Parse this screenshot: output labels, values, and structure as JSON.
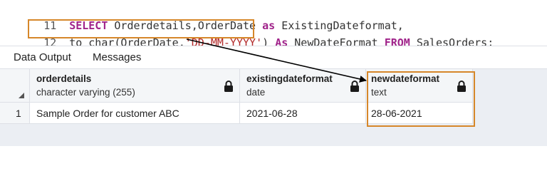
{
  "editor": {
    "lines": [
      {
        "number": "11",
        "tokens": [
          {
            "text": "SELECT",
            "kind": "keyword"
          },
          {
            "text": " Orderdetails,OrderDate ",
            "kind": "plain"
          },
          {
            "text": "as",
            "kind": "keyword"
          },
          {
            "text": " ExistingDateformat,",
            "kind": "plain"
          }
        ]
      },
      {
        "number": "12",
        "tokens": [
          {
            "text": "to_char(OrderDate,",
            "kind": "plain"
          },
          {
            "text": "'DD-MM-YYYY'",
            "kind": "string"
          },
          {
            "text": ") ",
            "kind": "plain"
          },
          {
            "text": "As",
            "kind": "keyword"
          },
          {
            "text": " NewDateFormat ",
            "kind": "plain"
          },
          {
            "text": "FROM",
            "kind": "keyword"
          },
          {
            "text": " SalesOrders;",
            "kind": "plain"
          }
        ]
      }
    ]
  },
  "tabs": [
    {
      "label": "Data Output",
      "active": true
    },
    {
      "label": "Messages",
      "active": false
    }
  ],
  "grid": {
    "columns": [
      {
        "name": "orderdetails",
        "type": "character varying (255)",
        "icon": "lock-icon"
      },
      {
        "name": "existingdateformat",
        "type": "date",
        "icon": "lock-icon"
      },
      {
        "name": "newdateformat",
        "type": "text",
        "icon": "lock-icon"
      }
    ],
    "rows": [
      {
        "row_number": "1",
        "cells": [
          "Sample Order for customer ABC",
          "2021-06-28",
          "28-06-2021"
        ]
      }
    ]
  },
  "colors": {
    "keyword": "#a0238a",
    "string": "#b22a2a",
    "highlight_box": "#d6872a",
    "arrow": "#000000",
    "grid_background": "#ebeef3"
  }
}
